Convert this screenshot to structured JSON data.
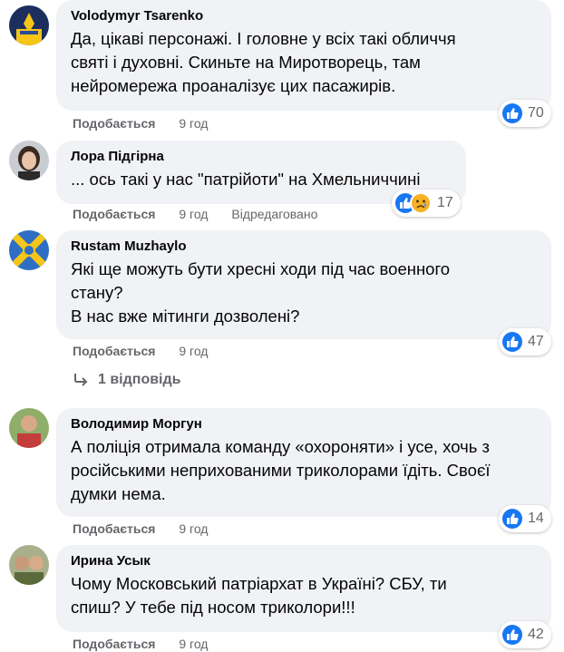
{
  "comments": [
    {
      "author": "Volodymyr Tsarenko",
      "lines": [
        "Да, цікаві персонажі. І головне у всіх такі обличчя",
        "святі і духовні. Скиньте на Миротворець, там",
        "нейромережа проаналізує цих пасажирів."
      ],
      "like_label": "Подобається",
      "time": "9 год",
      "reaction_count": "70",
      "reactions": [
        "like-icon"
      ]
    },
    {
      "author": "Лора Підгірна",
      "lines": [
        "... ось такі у нас \"патрійоти\" на Хмельниччині"
      ],
      "like_label": "Подобається",
      "time": "9 год",
      "edited": "Відредаговано",
      "reaction_count": "17",
      "reactions": [
        "like-icon",
        "sad-icon"
      ]
    },
    {
      "author": "Rustam Muzhaylo",
      "lines": [
        "Які ще можуть бути хресні ходи під час военного",
        "стану?",
        "В нас вже мітинги дозволені?"
      ],
      "like_label": "Подобається",
      "time": "9 год",
      "reaction_count": "47",
      "reactions": [
        "like-icon"
      ],
      "replies_label": "1 відповідь"
    },
    {
      "author": "Володимир Моргун",
      "lines": [
        "А поліція отримала команду «охороняти» і усе, хочь з",
        "російськими неприхованими триколорами їдіть. Своєї",
        "думки нема."
      ],
      "like_label": "Подобається",
      "time": "9 год",
      "reaction_count": "14",
      "reactions": [
        "like-icon"
      ]
    },
    {
      "author": "Ирина Усык",
      "lines": [
        "Чому Московський патріархат в Україні? СБУ, ти",
        "спиш? У тебе під носом триколори!!!"
      ],
      "like_label": "Подобається",
      "time": "9 год",
      "reaction_count": "42",
      "reactions": [
        "like-icon"
      ]
    }
  ],
  "colors": {
    "bubble_bg": "#f0f2f5",
    "like_blue": "#1877f2",
    "meta_gray": "#65676b",
    "text": "#050505"
  }
}
